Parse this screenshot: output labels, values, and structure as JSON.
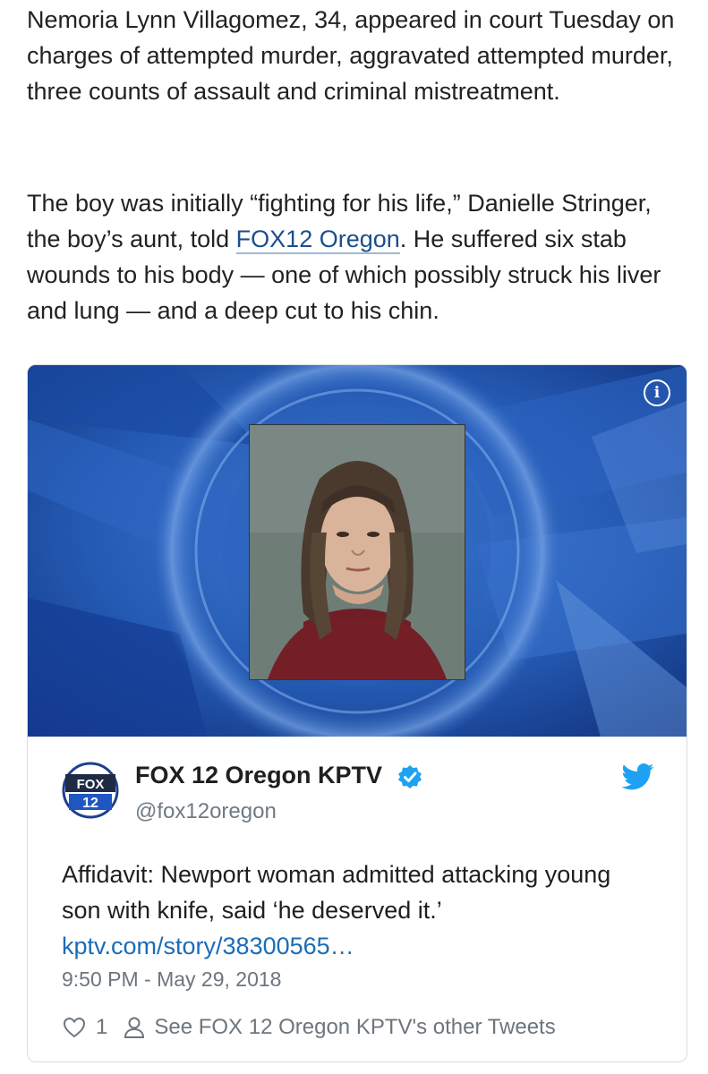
{
  "article": {
    "paragraph1": "Nemoria Lynn Villagomez, 34, appeared in court Tuesday on charges of attempted murder, aggravated attempted murder, three counts of assault and criminal mistreatment.",
    "paragraph2_before": "The boy was initially “fighting for his life,” Danielle Stringer, the boy’s aunt, told ",
    "paragraph2_link": "FOX12 Oregon",
    "paragraph2_after": ". He suffered six stab wounds to his body — one of which possibly struck his liver and lung — and a deep cut to his chin."
  },
  "tweet": {
    "display_name": "FOX 12 Oregon KPTV",
    "handle": "@fox12oregon",
    "text": "Affidavit: Newport woman admitted attacking young son with knife, said ‘he deserved it.’",
    "link": "kptv.com/story/38300565…",
    "timestamp": "9:50 PM - May 29, 2018",
    "like_count": "1",
    "other_tweets_label": "See FOX 12 Oregon KPTV's other Tweets",
    "avatar_logo_text": "FOX 12",
    "icons": {
      "info": "info-icon",
      "verified": "verified-badge-icon",
      "bird": "twitter-bird-icon",
      "like": "heart-icon",
      "profile": "person-icon"
    }
  },
  "colors": {
    "link": "#1a4f8c",
    "tweet_link": "#1b6cb6",
    "twitter_blue": "#1da1f2",
    "media_background": "#1b3f93"
  }
}
